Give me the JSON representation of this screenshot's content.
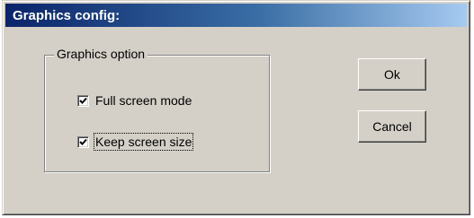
{
  "window": {
    "title": "Graphics config:"
  },
  "group": {
    "label": "Graphics option"
  },
  "options": [
    {
      "label": "Full screen mode",
      "checked": true
    },
    {
      "label": "Keep screen size",
      "checked": true
    }
  ],
  "buttons": {
    "ok_label": "Ok",
    "cancel_label": "Cancel"
  },
  "colors": {
    "titlebar_start": "#0a246a",
    "titlebar_end": "#a6caf0",
    "face": "#d4d0c8"
  }
}
